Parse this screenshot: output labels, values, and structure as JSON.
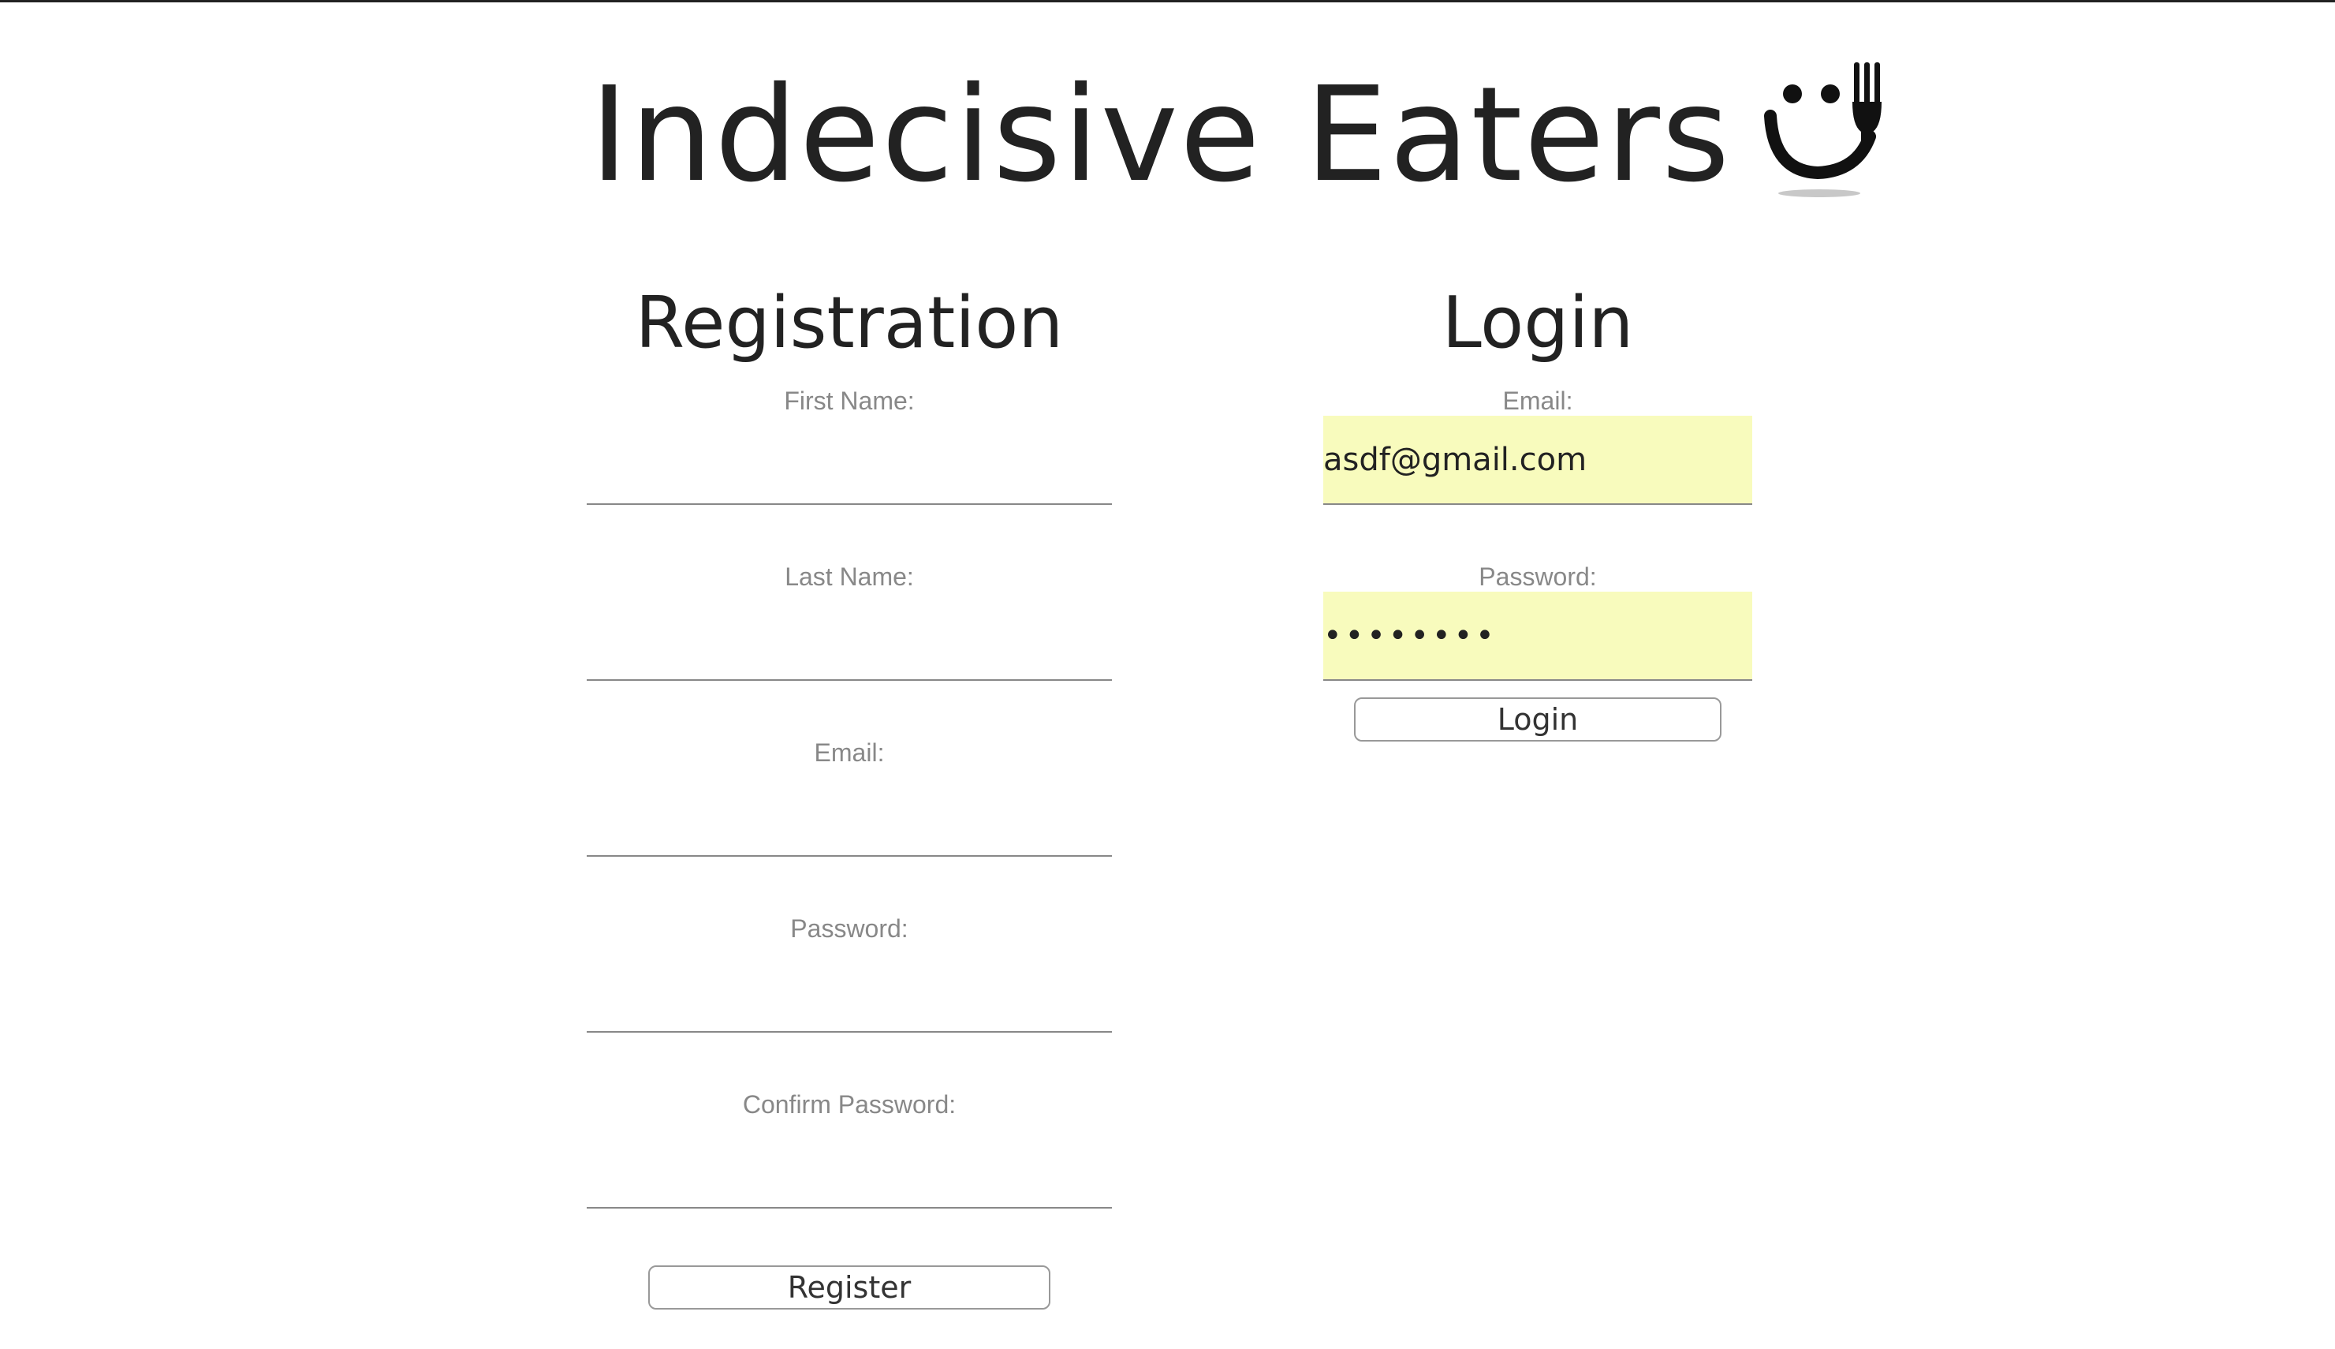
{
  "header": {
    "title": "Indecisive Eaters",
    "logo_icon": "smiley-fork-icon"
  },
  "registration": {
    "heading": "Registration",
    "fields": {
      "first_name": {
        "label": "First Name:",
        "value": ""
      },
      "last_name": {
        "label": "Last Name:",
        "value": ""
      },
      "email": {
        "label": "Email:",
        "value": ""
      },
      "password": {
        "label": "Password:",
        "value": ""
      },
      "confirm_password": {
        "label": "Confirm Password:",
        "value": ""
      }
    },
    "submit_label": "Register"
  },
  "login": {
    "heading": "Login",
    "fields": {
      "email": {
        "label": "Email:",
        "value": "asdf@gmail.com"
      },
      "password": {
        "label": "Password:",
        "value": "••••••••"
      }
    },
    "submit_label": "Login"
  },
  "colors": {
    "autofill_background": "#f8fbbd",
    "text": "#222222",
    "label": "#888888"
  }
}
